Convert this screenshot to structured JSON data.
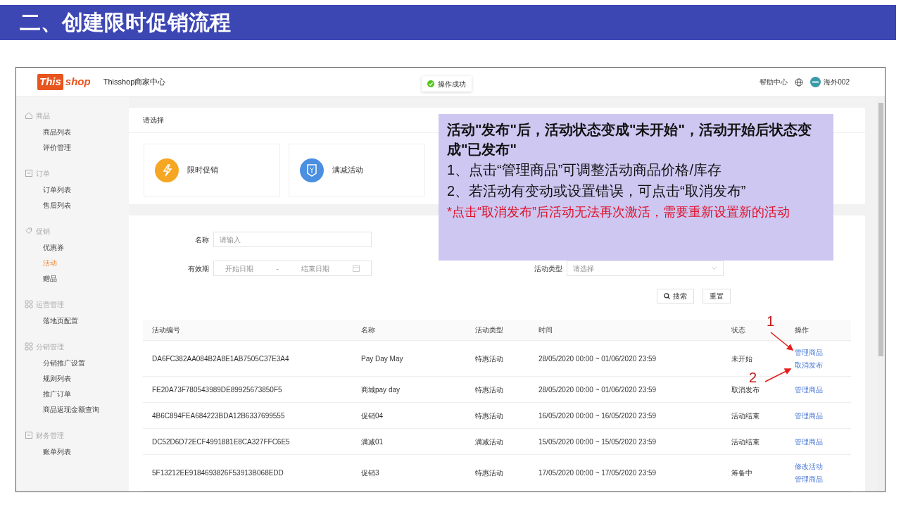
{
  "slide_title": "二、创建限时促销流程",
  "app": {
    "logo_words": [
      "This",
      "shop"
    ],
    "title": "Thisshop商家中心",
    "toast": "操作成功",
    "help": "帮助中心",
    "user": "海外002"
  },
  "sidebar": [
    {
      "label": "商品",
      "items": [
        {
          "label": "商品列表",
          "selected": false
        },
        {
          "label": "评价管理",
          "selected": false
        }
      ]
    },
    {
      "label": "订单",
      "items": [
        {
          "label": "订单列表",
          "selected": false
        },
        {
          "label": "售后列表",
          "selected": false
        }
      ]
    },
    {
      "label": "促销",
      "items": [
        {
          "label": "优惠券",
          "selected": false
        },
        {
          "label": "活动",
          "selected": true
        },
        {
          "label": "赠品",
          "selected": false
        }
      ]
    },
    {
      "label": "运营管理",
      "items": [
        {
          "label": "落地页配置",
          "selected": false
        }
      ]
    },
    {
      "label": "分销管理",
      "items": [
        {
          "label": "分销推广设置",
          "selected": false
        },
        {
          "label": "规则列表",
          "selected": false
        },
        {
          "label": "推广订单",
          "selected": false
        },
        {
          "label": "商品返现金额查询",
          "selected": false
        }
      ]
    },
    {
      "label": "财务管理",
      "items": [
        {
          "label": "账单列表",
          "selected": false
        }
      ]
    }
  ],
  "select_card": {
    "title": "请选择",
    "tiles": [
      {
        "label": "限时促销",
        "color": "#f5a623"
      },
      {
        "label": "满减活动",
        "color": "#4a8fe0"
      }
    ]
  },
  "filters": {
    "name": {
      "label": "名称",
      "placeholder": "请输入"
    },
    "period": {
      "label": "有效期",
      "start_placeholder": "开始日期",
      "separator": "-",
      "end_placeholder": "结束日期"
    },
    "type": {
      "label": "活动类型",
      "placeholder": "请选择"
    },
    "buttons": [
      "搜索",
      "重置"
    ]
  },
  "table": {
    "columns": [
      "活动编号",
      "名称",
      "活动类型",
      "时间",
      "状态",
      "操作"
    ],
    "rows": [
      {
        "cells": [
          "DA6FC382AA084B2A8E1AB7505C37E3A4",
          "Pay Day May",
          "特惠活动",
          "28/05/2020 00:00 ~ 01/06/2020 23:59",
          "未开始"
        ],
        "actions": [
          "管理商品",
          "取消发布"
        ]
      },
      {
        "cells": [
          "FE20A73F780543989DE89925673850F5",
          "商城pay day",
          "特惠活动",
          "28/05/2020 00:00 ~ 01/06/2020 23:59",
          "取消发布"
        ],
        "actions": [
          "管理商品"
        ]
      },
      {
        "cells": [
          "4B6C894FEA684223BDA12B6337699555",
          "促销04",
          "特惠活动",
          "16/05/2020 00:00 ~ 16/05/2020 23:59",
          "活动结束"
        ],
        "actions": [
          "管理商品"
        ]
      },
      {
        "cells": [
          "DC52D6D72ECF4991881E8CA327FFC6E5",
          "满减01",
          "满减活动",
          "15/05/2020 00:00 ~ 15/05/2020 23:59",
          "活动结束"
        ],
        "actions": [
          "管理商品"
        ]
      },
      {
        "cells": [
          "5F13212EE9184693826F53913B068EDD",
          "促销3",
          "特惠活动",
          "17/05/2020 00:00 ~ 17/05/2020 23:59",
          "筹备中"
        ],
        "actions": [
          "修改活动",
          "管理商品"
        ]
      }
    ]
  },
  "callout": {
    "heading": "活动\"发布\"后，活动状态变成\"未开始\"，活动开始后状态变成\"已发布\"",
    "lines": [
      "1、点击“管理商品”可调整活动商品价格/库存",
      "2、若活动有变动或设置错误，可点击“取消发布”"
    ],
    "warning": "*点击“取消发布”后活动无法再次激活，需要重新设置新的活动"
  },
  "markers": [
    "1",
    "2"
  ]
}
